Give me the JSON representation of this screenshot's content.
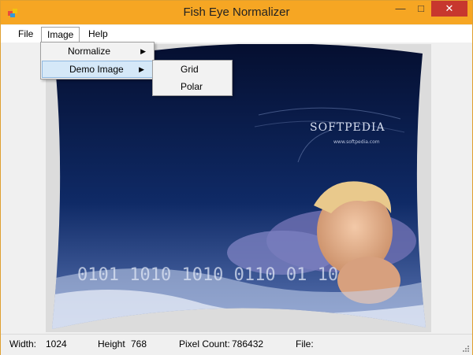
{
  "window": {
    "title": "Fish Eye Normalizer",
    "minimize": "—",
    "maximize": "□",
    "close": "✕"
  },
  "menubar": {
    "file": "File",
    "image": "Image",
    "help": "Help"
  },
  "image_menu": {
    "items": [
      {
        "label": "Normalize"
      },
      {
        "label": "Demo Image"
      }
    ]
  },
  "demo_submenu": {
    "items": [
      {
        "label": "Grid"
      },
      {
        "label": "Polar"
      }
    ]
  },
  "canvas": {
    "watermark": "SOFTPEDIA",
    "site": "www.softpedia.com",
    "digits": "0101 1010 1010 0110 01 10"
  },
  "status": {
    "width_label": "Width:",
    "width_value": "1024",
    "height_label": "Height",
    "height_value": "768",
    "pixel_label": "Pixel Count:",
    "pixel_value": "786432",
    "file_label": "File:"
  },
  "colors": {
    "titlebar": "#f6a623",
    "close": "#c7372e",
    "sky": "#0b1f4d",
    "highlight": "#d5e8f8"
  }
}
